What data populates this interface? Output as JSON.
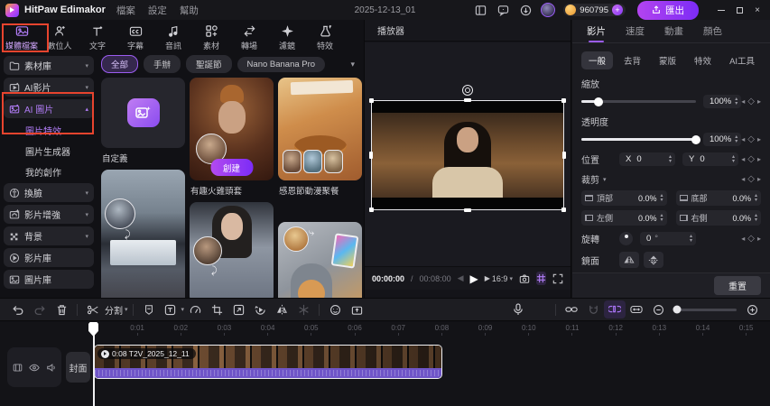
{
  "titlebar": {
    "app_name": "HitPaw Edimakor",
    "menu_file": "檔案",
    "menu_settings": "設定",
    "menu_help": "幫助",
    "project_name": "2025-12-13_01",
    "credits": "960795",
    "add_credits": "+",
    "export_label": "匯出",
    "accent_color": "#9b4dff",
    "highlight_color": "#e8442e"
  },
  "tools": [
    {
      "label": "媒體檔案"
    },
    {
      "label": "數位人"
    },
    {
      "label": "文字"
    },
    {
      "label": "字幕"
    },
    {
      "label": "音訊"
    },
    {
      "label": "素材"
    },
    {
      "label": "轉場"
    },
    {
      "label": "濾鏡"
    },
    {
      "label": "特效"
    }
  ],
  "sidebar": {
    "library": "素材庫",
    "ai_video": "AI影片",
    "ai_image": "AI 圖片",
    "image_effects": "圖片特效",
    "image_generator": "圖片生成器",
    "my_creations": "我的創作",
    "face_swap": "換臉",
    "video_enhance": "影片增強",
    "background": "背景",
    "video_library": "影片庫",
    "image_library": "圖片庫"
  },
  "content": {
    "tab_all": "全部",
    "tab_figure": "手辦",
    "tab_christmas": "聖誕節",
    "tab_nano": "Nano Banana Pro",
    "card_custom": "自定義",
    "card_turkey": "有趣火雞頭套",
    "card_turkey_button": "創建",
    "card_thanksgiving": "感恩節動漫聚餐"
  },
  "player": {
    "title": "播放器",
    "current_time": "00:00:00",
    "time_separator": "/",
    "total_time": "00:08:00",
    "aspect_ratio": "16:9"
  },
  "properties": {
    "tab_video": "影片",
    "tab_speed": "速度",
    "tab_animation": "動畫",
    "tab_color": "顏色",
    "sub_general": "一般",
    "sub_remove_bg": "去背",
    "sub_mask": "蒙版",
    "sub_effects": "特效",
    "sub_ai_tools": "AI工具",
    "scale": {
      "label": "縮放",
      "value": "100%"
    },
    "opacity": {
      "label": "透明度",
      "value": "100%"
    },
    "position": {
      "label": "位置",
      "x_label": "X",
      "x_value": "0",
      "y_label": "Y",
      "y_value": "0"
    },
    "crop": {
      "label": "裁剪",
      "fields": [
        {
          "label": "頂部",
          "value": "0.0%"
        },
        {
          "label": "底部",
          "value": "0.0%"
        },
        {
          "label": "左側",
          "value": "0.0%"
        },
        {
          "label": "右側",
          "value": "0.0%"
        }
      ]
    },
    "rotate": {
      "label": "旋轉",
      "value": "0",
      "unit": "°"
    },
    "mirror_label": "鏡面",
    "flip_label": "反轉",
    "reset_label": "重置"
  },
  "timeline_toolbar": {
    "split_label": "分割"
  },
  "timeline": {
    "ruler": [
      "0:01",
      "0:02",
      "0:03",
      "0:04",
      "0:05",
      "0:06",
      "0:07",
      "0:08",
      "0:09",
      "0:10",
      "0:11",
      "0:12",
      "0:13",
      "0:14",
      "0:15"
    ],
    "cover_label": "封面",
    "clip_label": "0:08 T2V_2025_12_11"
  }
}
